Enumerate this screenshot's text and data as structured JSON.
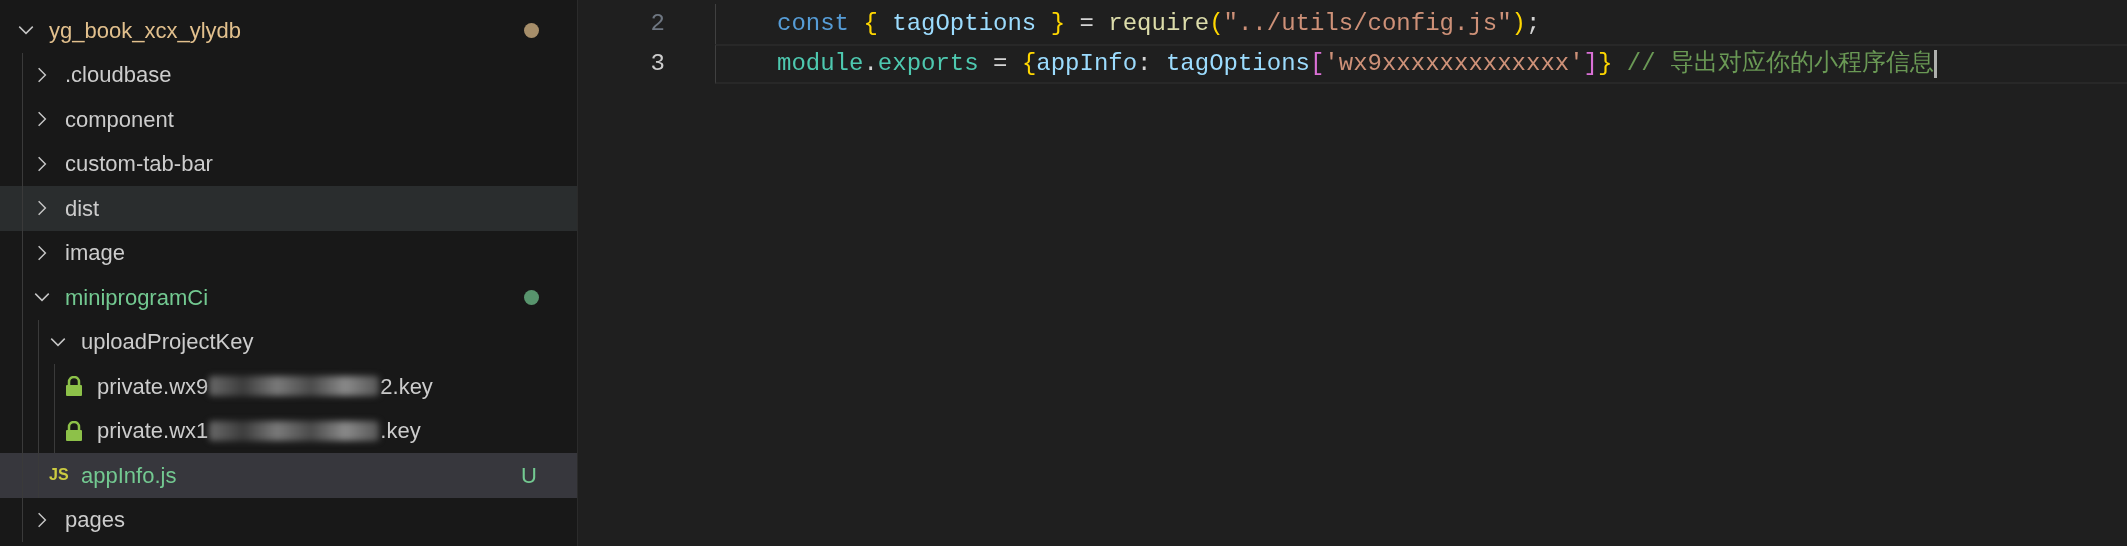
{
  "explorer": {
    "items": [
      {
        "name": "yg_book_xcx_ylydb",
        "kind": "folder",
        "expanded": true,
        "selected": false,
        "hovered": false,
        "color": "#e2c08d",
        "children": [
          {
            "name": ".cloudbase",
            "kind": "folder",
            "expanded": false,
            "selected": false,
            "hovered": false
          },
          {
            "name": "component",
            "kind": "folder",
            "expanded": false,
            "selected": false,
            "hovered": false
          },
          {
            "name": "custom-tab-bar",
            "kind": "folder",
            "expanded": false,
            "selected": false,
            "hovered": false
          },
          {
            "name": "dist",
            "kind": "folder",
            "expanded": false,
            "selected": false,
            "hovered": true
          },
          {
            "name": "image",
            "kind": "folder",
            "expanded": false,
            "selected": false,
            "hovered": false
          },
          {
            "name": "miniprogramCi",
            "kind": "folder",
            "expanded": true,
            "selected": false,
            "hovered": false,
            "color": "#73c991",
            "children": [
              {
                "name": "uploadProjectKey",
                "kind": "folder",
                "expanded": true,
                "selected": false,
                "hovered": false,
                "children": [
                  {
                    "name": "private.wx9",
                    "name_end": "2.key",
                    "kind": "key",
                    "selected": false,
                    "hovered": false
                  },
                  {
                    "name": "private.wx1",
                    "name_end": ".key",
                    "kind": "key",
                    "selected": false,
                    "hovered": false
                  }
                ]
              },
              {
                "name": "appInfo.js",
                "kind": "js",
                "icon_text": "JS",
                "selected": true,
                "hovered": false,
                "color": "#73c991",
                "badge": "U"
              }
            ]
          },
          {
            "name": "pages",
            "kind": "folder",
            "expanded": false,
            "selected": false,
            "hovered": false
          }
        ]
      }
    ]
  },
  "editor": {
    "lines": [
      {
        "number": "2",
        "current": false,
        "tokens": [
          {
            "text": "const ",
            "kind": "keyword"
          },
          {
            "text": "{ ",
            "kind": "brace"
          },
          {
            "text": "tagOptions ",
            "kind": "variable"
          },
          {
            "text": "} ",
            "kind": "brace"
          },
          {
            "text": "= ",
            "kind": "plain"
          },
          {
            "text": "require",
            "kind": "function"
          },
          {
            "text": "(",
            "kind": "brace"
          },
          {
            "text": "\"../utils/config.js\"",
            "kind": "string"
          },
          {
            "text": ")",
            "kind": "brace"
          },
          {
            "text": ";",
            "kind": "plain"
          }
        ]
      },
      {
        "number": "3",
        "current": true,
        "tokens": [
          {
            "text": "module",
            "kind": "type"
          },
          {
            "text": ".",
            "kind": "plain"
          },
          {
            "text": "exports",
            "kind": "type"
          },
          {
            "text": " = ",
            "kind": "plain"
          },
          {
            "text": "{",
            "kind": "brace"
          },
          {
            "text": "appInfo",
            "kind": "variable"
          },
          {
            "text": ": ",
            "kind": "plain"
          },
          {
            "text": "tagOptions",
            "kind": "variable"
          },
          {
            "text": "[",
            "kind": "bracket"
          },
          {
            "text": "'wx9xxxxxxxxxxxxx'",
            "kind": "string"
          },
          {
            "text": "]",
            "kind": "bracket"
          },
          {
            "text": "}",
            "kind": "brace"
          },
          {
            "text": " // 导出对应你的小程序信息",
            "kind": "comment"
          }
        ]
      }
    ]
  }
}
